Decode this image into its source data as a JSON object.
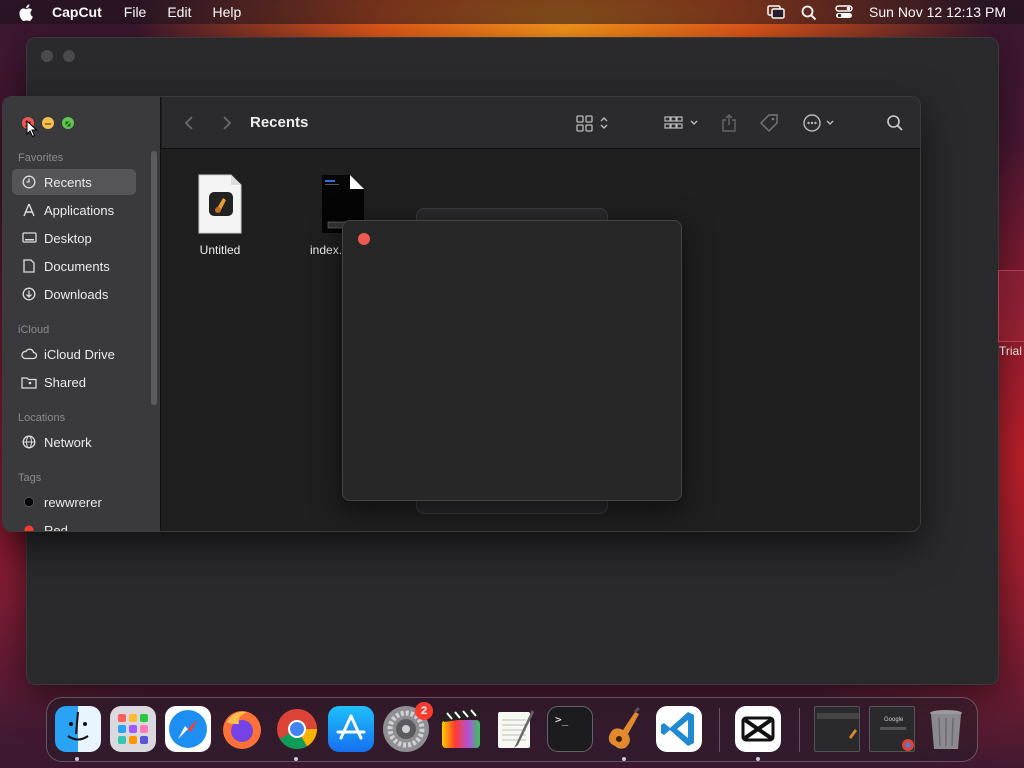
{
  "menubar": {
    "app_name": "CapCut",
    "menus": [
      "File",
      "Edit",
      "Help"
    ],
    "clock": "Sun Nov 12  12:13 PM"
  },
  "background_window": {
    "trial_label": "Trial"
  },
  "finder": {
    "title": "Recents",
    "sidebar": {
      "favorites_title": "Favorites",
      "favorites": [
        {
          "label": "Recents",
          "icon": "clock-icon",
          "selected": true
        },
        {
          "label": "Applications",
          "icon": "applications-icon"
        },
        {
          "label": "Desktop",
          "icon": "desktop-icon"
        },
        {
          "label": "Documents",
          "icon": "document-icon"
        },
        {
          "label": "Downloads",
          "icon": "download-icon"
        }
      ],
      "icloud_title": "iCloud",
      "icloud": [
        {
          "label": "iCloud Drive",
          "icon": "cloud-icon"
        },
        {
          "label": "Shared",
          "icon": "shared-folder-icon"
        }
      ],
      "locations_title": "Locations",
      "locations": [
        {
          "label": "Network",
          "icon": "globe-icon"
        }
      ],
      "tags_title": "Tags",
      "tags": [
        {
          "label": "rewwrerer",
          "color": "#000000"
        },
        {
          "label": "Red",
          "color": "#ff3b30"
        }
      ]
    },
    "files": [
      {
        "label": "Untitled",
        "icon": "garageband-document-icon"
      },
      {
        "label": "index.h",
        "icon": "html-file-icon"
      }
    ]
  },
  "dock": {
    "apps": [
      {
        "name": "Finder",
        "icon": "finder-icon",
        "running": true
      },
      {
        "name": "Launchpad",
        "icon": "launchpad-icon"
      },
      {
        "name": "Safari",
        "icon": "safari-icon"
      },
      {
        "name": "Firefox",
        "icon": "firefox-icon"
      },
      {
        "name": "Chrome",
        "icon": "chrome-icon",
        "running": true
      },
      {
        "name": "App Store",
        "icon": "app-store-icon"
      },
      {
        "name": "System Settings",
        "icon": "settings-gear-icon",
        "badge": "2"
      },
      {
        "name": "Final Cut Pro",
        "icon": "final-cut-icon"
      },
      {
        "name": "TextEdit",
        "icon": "textedit-icon"
      },
      {
        "name": "Terminal",
        "icon": "terminal-icon"
      },
      {
        "name": "GarageBand",
        "icon": "garageband-icon",
        "running": true
      },
      {
        "name": "VS Code",
        "icon": "vscode-icon"
      },
      {
        "name": "CapCut",
        "icon": "capcut-icon",
        "running": true
      }
    ],
    "terminal_prompt": ">_",
    "settings_badge": "2",
    "chrome_thumb_label": "Google"
  },
  "colors": {
    "close": "#ee5a52",
    "minimize": "#f5bf4f",
    "maximize": "#61c454",
    "selection": "#555558"
  }
}
